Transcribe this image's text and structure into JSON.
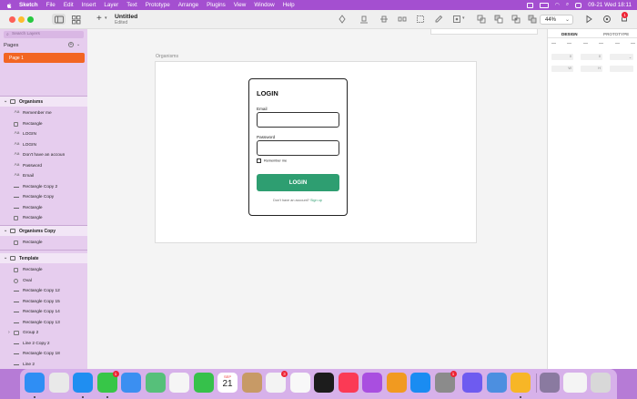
{
  "menubar": {
    "items": [
      "Sketch",
      "File",
      "Edit",
      "Insert",
      "Layer",
      "Text",
      "Prototype",
      "Arrange",
      "Plugins",
      "View",
      "Window",
      "Help"
    ],
    "datetime": "09-21 Wed  18:11"
  },
  "toolbar": {
    "doc_title": "Untitled",
    "doc_subtitle": "Edited",
    "zoom": "44%",
    "notification_count": "1"
  },
  "sidebar": {
    "search_placeholder": "Search Layers",
    "pages_label": "Pages",
    "active_page": "Page 1",
    "groups": [
      {
        "name": "Organisms",
        "layers": [
          {
            "icon": "Aa",
            "label": "Remember me"
          },
          {
            "icon": "rect",
            "label": "Rectangle"
          },
          {
            "icon": "Aa",
            "label": "LOGIN"
          },
          {
            "icon": "Aa",
            "label": "LOGIN"
          },
          {
            "icon": "Aa",
            "label": "Don't have an accoun"
          },
          {
            "icon": "Aa",
            "label": "Password"
          },
          {
            "icon": "Aa",
            "label": "Email"
          },
          {
            "icon": "line",
            "label": "Rectangle Copy 2"
          },
          {
            "icon": "line",
            "label": "Rectangle Copy"
          },
          {
            "icon": "line",
            "label": "Rectangle"
          },
          {
            "icon": "rect",
            "label": "Rectangle"
          }
        ]
      },
      {
        "name": "Organisms Copy",
        "layers": [
          {
            "icon": "rect",
            "label": "Rectangle"
          }
        ]
      },
      {
        "name": "Template",
        "layers": [
          {
            "icon": "rect",
            "label": "Rectangle"
          },
          {
            "icon": "oval",
            "label": "Oval"
          },
          {
            "icon": "line",
            "label": "Rectangle Copy 12"
          },
          {
            "icon": "line",
            "label": "Rectangle Copy 15"
          },
          {
            "icon": "line",
            "label": "Rectangle Copy 14"
          },
          {
            "icon": "line",
            "label": "Rectangle Copy 13"
          },
          {
            "icon": "group",
            "label": "Group 2"
          },
          {
            "icon": "line",
            "label": "Line 2 Copy 2"
          },
          {
            "icon": "line",
            "label": "Rectangle Copy 18"
          },
          {
            "icon": "line",
            "label": "Line 2"
          },
          {
            "icon": "line",
            "label": "Rectangle Copy 16"
          }
        ]
      }
    ]
  },
  "canvas": {
    "artboard_label": "Organisms",
    "login_card": {
      "title": "LOGIN",
      "email_label": "Email",
      "password_label": "Password",
      "remember_label": "Remember me",
      "button_label": "LOGIN",
      "signup_text": "Don't have an account?",
      "signup_link": "Sign up"
    }
  },
  "inspector": {
    "tabs": [
      "DESIGN",
      "PROTOTYPE"
    ],
    "field_x": "0",
    "field_y": "0",
    "field_w": "W",
    "field_h": "H"
  },
  "dock": {
    "calendar_month": "SEP",
    "calendar_day": "21",
    "apps": [
      {
        "name": "Finder",
        "color": "#2f8ef4",
        "badge": ""
      },
      {
        "name": "Launchpad",
        "color": "#e9e9e9",
        "badge": ""
      },
      {
        "name": "Safari",
        "color": "#1f8ef1",
        "badge": ""
      },
      {
        "name": "Messages",
        "color": "#37c648",
        "badge": "1"
      },
      {
        "name": "Mail",
        "color": "#3b8ff1",
        "badge": ""
      },
      {
        "name": "Maps",
        "color": "#56c07a",
        "badge": ""
      },
      {
        "name": "Photos",
        "color": "#f5f5f5",
        "badge": ""
      },
      {
        "name": "FaceTime",
        "color": "#36c14b",
        "badge": ""
      },
      {
        "name": "Calendar",
        "color": "#ffffff",
        "badge": ""
      },
      {
        "name": "Contacts",
        "color": "#c79a66",
        "badge": ""
      },
      {
        "name": "Reminders",
        "color": "#f3f3f3",
        "badge": "3"
      },
      {
        "name": "Notes",
        "color": "#f8f8f8",
        "badge": ""
      },
      {
        "name": "TV",
        "color": "#1c1c1c",
        "badge": ""
      },
      {
        "name": "Music",
        "color": "#fb3a55",
        "badge": ""
      },
      {
        "name": "Podcasts",
        "color": "#a94ee0",
        "badge": ""
      },
      {
        "name": "Keynote",
        "color": "#f19a20",
        "badge": ""
      },
      {
        "name": "App Store",
        "color": "#1a8cf2",
        "badge": ""
      },
      {
        "name": "System Preferences",
        "color": "#8b8b8b",
        "badge": "1"
      },
      {
        "name": "Screen Time",
        "color": "#6e5bf0",
        "badge": ""
      },
      {
        "name": "Preview",
        "color": "#4c8fe0",
        "badge": ""
      },
      {
        "name": "Sketch",
        "color": "#f7b626",
        "badge": ""
      }
    ],
    "right_items": [
      {
        "name": "Folder",
        "color": "#8a7aa0"
      },
      {
        "name": "Window",
        "color": "#f4f4f4"
      },
      {
        "name": "Trash",
        "color": "#d8d8d8"
      }
    ]
  }
}
